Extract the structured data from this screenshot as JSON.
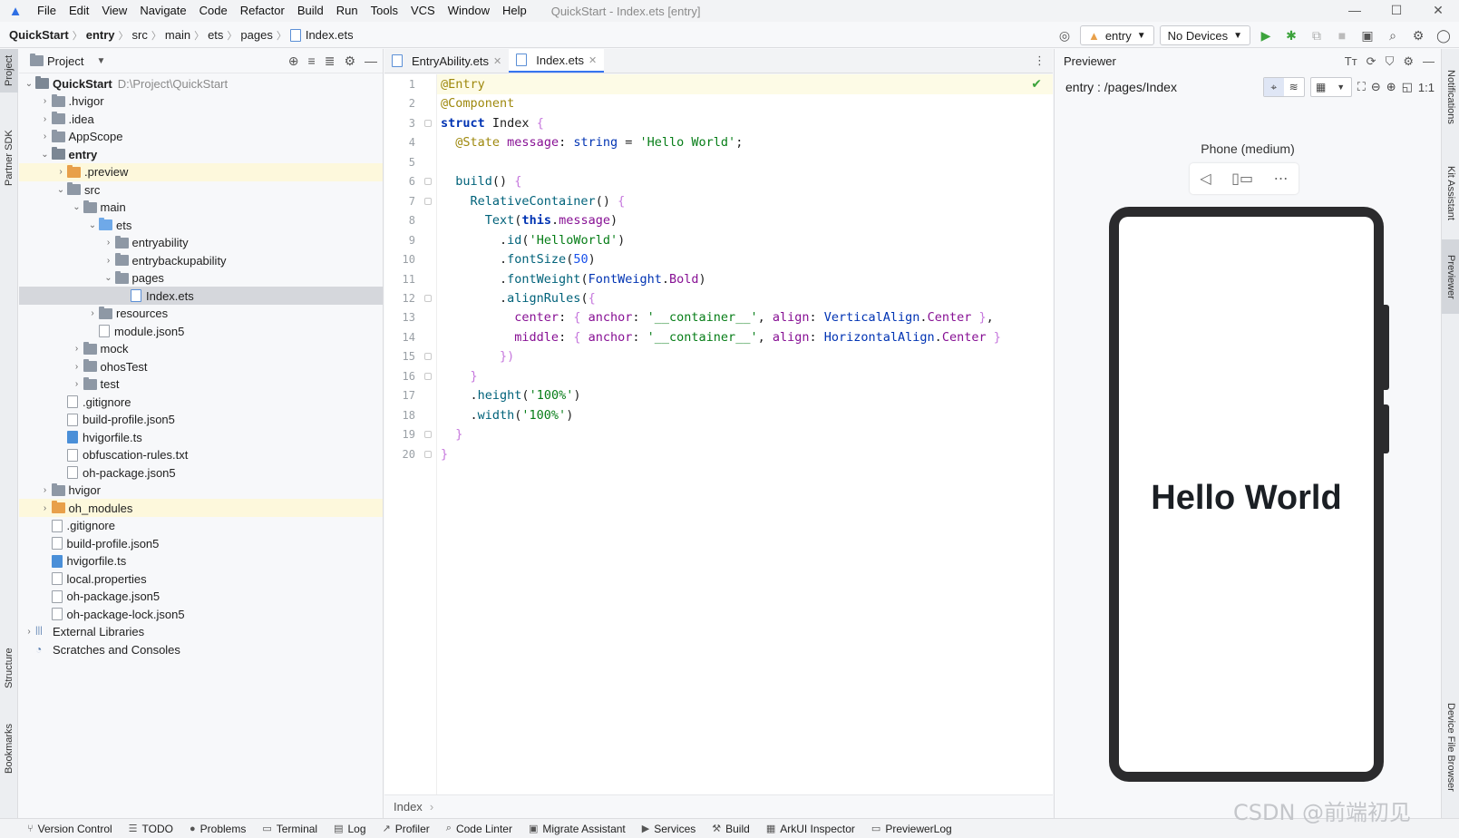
{
  "window": {
    "title": "QuickStart - Index.ets [entry]",
    "menu": [
      "File",
      "Edit",
      "View",
      "Navigate",
      "Code",
      "Refactor",
      "Build",
      "Run",
      "Tools",
      "VCS",
      "Window",
      "Help"
    ],
    "controls": [
      "—",
      "☐",
      "✕"
    ]
  },
  "navbar": {
    "breadcrumb": [
      "QuickStart",
      "entry",
      "src",
      "main",
      "ets",
      "pages",
      "Index.ets"
    ],
    "module_combo": "entry",
    "device_combo": "No Devices"
  },
  "left_stripe": {
    "tabs": [
      "Project",
      "Partner SDK",
      "Structure",
      "Bookmarks"
    ]
  },
  "right_stripe": {
    "tabs": [
      "Notifications",
      "Kit Assistant",
      "Previewer",
      "Device File Browser"
    ]
  },
  "project_panel": {
    "title": "Project",
    "tree": [
      {
        "label": "QuickStart",
        "extra": "D:\\Project\\QuickStart",
        "depth": 0,
        "kind": "module",
        "expand": "open",
        "bold": true
      },
      {
        "label": ".hvigor",
        "depth": 1,
        "kind": "folder",
        "expand": "closed"
      },
      {
        "label": ".idea",
        "depth": 1,
        "kind": "folder",
        "expand": "closed"
      },
      {
        "label": "AppScope",
        "depth": 1,
        "kind": "folder",
        "expand": "closed"
      },
      {
        "label": "entry",
        "depth": 1,
        "kind": "module",
        "expand": "open",
        "bold": true
      },
      {
        "label": ".preview",
        "depth": 2,
        "kind": "folder-orange",
        "expand": "closed",
        "state": "highlight"
      },
      {
        "label": "src",
        "depth": 2,
        "kind": "folder",
        "expand": "open"
      },
      {
        "label": "main",
        "depth": 3,
        "kind": "folder",
        "expand": "open"
      },
      {
        "label": "ets",
        "depth": 4,
        "kind": "folder-blue",
        "expand": "open"
      },
      {
        "label": "entryability",
        "depth": 5,
        "kind": "folder",
        "expand": "closed"
      },
      {
        "label": "entrybackupability",
        "depth": 5,
        "kind": "folder",
        "expand": "closed"
      },
      {
        "label": "pages",
        "depth": 5,
        "kind": "folder",
        "expand": "open"
      },
      {
        "label": "Index.ets",
        "depth": 6,
        "kind": "file-ets",
        "expand": "none",
        "state": "selected"
      },
      {
        "label": "resources",
        "depth": 4,
        "kind": "folder",
        "expand": "closed"
      },
      {
        "label": "module.json5",
        "depth": 4,
        "kind": "file",
        "expand": "none"
      },
      {
        "label": "mock",
        "depth": 3,
        "kind": "folder",
        "expand": "closed"
      },
      {
        "label": "ohosTest",
        "depth": 3,
        "kind": "folder",
        "expand": "closed"
      },
      {
        "label": "test",
        "depth": 3,
        "kind": "folder",
        "expand": "closed"
      },
      {
        "label": ".gitignore",
        "depth": 2,
        "kind": "file",
        "expand": "none"
      },
      {
        "label": "build-profile.json5",
        "depth": 2,
        "kind": "file",
        "expand": "none"
      },
      {
        "label": "hvigorfile.ts",
        "depth": 2,
        "kind": "file-ts",
        "expand": "none"
      },
      {
        "label": "obfuscation-rules.txt",
        "depth": 2,
        "kind": "file",
        "expand": "none"
      },
      {
        "label": "oh-package.json5",
        "depth": 2,
        "kind": "file",
        "expand": "none"
      },
      {
        "label": "hvigor",
        "depth": 1,
        "kind": "folder",
        "expand": "closed"
      },
      {
        "label": "oh_modules",
        "depth": 1,
        "kind": "folder-orange",
        "expand": "closed",
        "state": "highlight"
      },
      {
        "label": ".gitignore",
        "depth": 1,
        "kind": "file",
        "expand": "none"
      },
      {
        "label": "build-profile.json5",
        "depth": 1,
        "kind": "file",
        "expand": "none"
      },
      {
        "label": "hvigorfile.ts",
        "depth": 1,
        "kind": "file-ts",
        "expand": "none"
      },
      {
        "label": "local.properties",
        "depth": 1,
        "kind": "file",
        "expand": "none"
      },
      {
        "label": "oh-package.json5",
        "depth": 1,
        "kind": "file",
        "expand": "none"
      },
      {
        "label": "oh-package-lock.json5",
        "depth": 1,
        "kind": "file",
        "expand": "none"
      },
      {
        "label": "External Libraries",
        "depth": 0,
        "kind": "libs",
        "expand": "closed"
      },
      {
        "label": "Scratches and Consoles",
        "depth": 0,
        "kind": "scratch",
        "expand": "none"
      }
    ]
  },
  "editor": {
    "tabs": [
      {
        "label": "EntryAbility.ets",
        "active": false
      },
      {
        "label": "Index.ets",
        "active": true
      }
    ],
    "lines": [
      [
        [
          "ann",
          "@Entry"
        ]
      ],
      [
        [
          "ann",
          "@Component"
        ]
      ],
      [
        [
          "kw",
          "struct"
        ],
        [
          "",
          " Index "
        ],
        [
          "br",
          "{"
        ]
      ],
      [
        [
          "",
          "  "
        ],
        [
          "ann",
          "@State"
        ],
        [
          "prop",
          " message"
        ],
        [
          "",
          ": "
        ],
        [
          "typ",
          "string"
        ],
        [
          "",
          " = "
        ],
        [
          "str",
          "'Hello World'"
        ],
        [
          "",
          ";"
        ]
      ],
      [],
      [
        [
          "",
          "  "
        ],
        [
          "fn",
          "build"
        ],
        [
          "",
          "() "
        ],
        [
          "br",
          "{"
        ]
      ],
      [
        [
          "",
          "    "
        ],
        [
          "fn",
          "RelativeContainer"
        ],
        [
          "",
          "() "
        ],
        [
          "br",
          "{"
        ]
      ],
      [
        [
          "",
          "      "
        ],
        [
          "fn",
          "Text"
        ],
        [
          "",
          "("
        ],
        [
          "kw",
          "this"
        ],
        [
          "",
          "."
        ],
        [
          "prop",
          "message"
        ],
        [
          "",
          ")"
        ]
      ],
      [
        [
          "",
          "        ."
        ],
        [
          "fn",
          "id"
        ],
        [
          "",
          "("
        ],
        [
          "str",
          "'HelloWorld'"
        ],
        [
          "",
          ")"
        ]
      ],
      [
        [
          "",
          "        ."
        ],
        [
          "fn",
          "fontSize"
        ],
        [
          "",
          "("
        ],
        [
          "num",
          "50"
        ],
        [
          "",
          ")"
        ]
      ],
      [
        [
          "",
          "        ."
        ],
        [
          "fn",
          "fontWeight"
        ],
        [
          "",
          "("
        ],
        [
          "typ",
          "FontWeight"
        ],
        [
          "",
          "."
        ],
        [
          "prop",
          "Bold"
        ],
        [
          "",
          ")"
        ]
      ],
      [
        [
          "",
          "        ."
        ],
        [
          "fn",
          "alignRules"
        ],
        [
          "",
          "("
        ],
        [
          "br",
          "{"
        ]
      ],
      [
        [
          "",
          "          "
        ],
        [
          "prop",
          "center"
        ],
        [
          "",
          ": "
        ],
        [
          "br",
          "{"
        ],
        [
          "",
          " "
        ],
        [
          "prop",
          "anchor"
        ],
        [
          "",
          ": "
        ],
        [
          "str",
          "'__container__'"
        ],
        [
          "",
          ", "
        ],
        [
          "prop",
          "align"
        ],
        [
          "",
          ": "
        ],
        [
          "typ",
          "VerticalAlign"
        ],
        [
          "",
          "."
        ],
        [
          "prop",
          "Center"
        ],
        [
          "",
          " "
        ],
        [
          "br",
          "}"
        ],
        [
          "",
          ","
        ]
      ],
      [
        [
          "",
          "          "
        ],
        [
          "prop",
          "middle"
        ],
        [
          "",
          ": "
        ],
        [
          "br",
          "{"
        ],
        [
          "",
          " "
        ],
        [
          "prop",
          "anchor"
        ],
        [
          "",
          ": "
        ],
        [
          "str",
          "'__container__'"
        ],
        [
          "",
          ", "
        ],
        [
          "prop",
          "align"
        ],
        [
          "",
          ": "
        ],
        [
          "typ",
          "HorizontalAlign"
        ],
        [
          "",
          "."
        ],
        [
          "prop",
          "Center"
        ],
        [
          "",
          " "
        ],
        [
          "br",
          "}"
        ]
      ],
      [
        [
          "",
          "        "
        ],
        [
          "br",
          "})"
        ]
      ],
      [
        [
          "",
          "    "
        ],
        [
          "br",
          "}"
        ]
      ],
      [
        [
          "",
          "    ."
        ],
        [
          "fn",
          "height"
        ],
        [
          "",
          "("
        ],
        [
          "str",
          "'100%'"
        ],
        [
          "",
          ")"
        ]
      ],
      [
        [
          "",
          "    ."
        ],
        [
          "fn",
          "width"
        ],
        [
          "",
          "("
        ],
        [
          "str",
          "'100%'"
        ],
        [
          "",
          ")"
        ]
      ],
      [
        [
          "",
          "  "
        ],
        [
          "br",
          "}"
        ]
      ],
      [
        [
          "br",
          "}"
        ]
      ]
    ],
    "footer": "Index",
    "inspection_ok": "✔"
  },
  "previewer": {
    "title": "Previewer",
    "route": "entry : /pages/Index",
    "device": "Phone (medium)",
    "screen_text": "Hello World"
  },
  "bottom_bar": {
    "items": [
      "Version Control",
      "TODO",
      "Problems",
      "Terminal",
      "Log",
      "Profiler",
      "Code Linter",
      "Migrate Assistant",
      "Services",
      "Build",
      "ArkUI Inspector",
      "PreviewerLog"
    ]
  },
  "watermark": "CSDN @前端初见"
}
